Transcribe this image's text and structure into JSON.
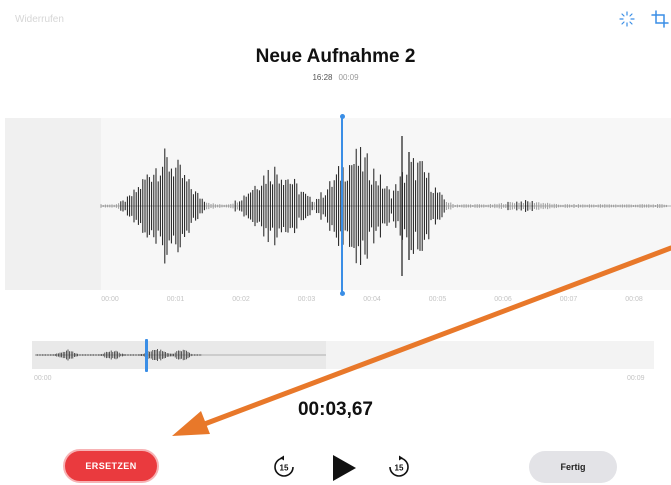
{
  "toolbar": {
    "undo_label": "Widerrufen",
    "enhance_icon": "enhance-icon",
    "crop_icon": "crop-icon"
  },
  "recording": {
    "title": "Neue Aufnahme 2",
    "time_of_day": "16:28",
    "duration": "00:09"
  },
  "timeline_labels": [
    "00:00",
    "00:01",
    "00:02",
    "00:03",
    "00:04",
    "00:05",
    "00:06",
    "00:07",
    "00:08"
  ],
  "overview": {
    "start_label": "00:00",
    "end_label": "00:09"
  },
  "player": {
    "current_time": "00:03,67",
    "skip_back_label": "15",
    "skip_forward_label": "15",
    "play_icon": "play-icon"
  },
  "actions": {
    "replace_label": "ERSETZEN",
    "done_label": "Fertig"
  },
  "colors": {
    "accent": "#3a8ee6",
    "replace": "#ea3a3e",
    "annotation": "#e8782a",
    "waveform": "#1a1a1a"
  }
}
